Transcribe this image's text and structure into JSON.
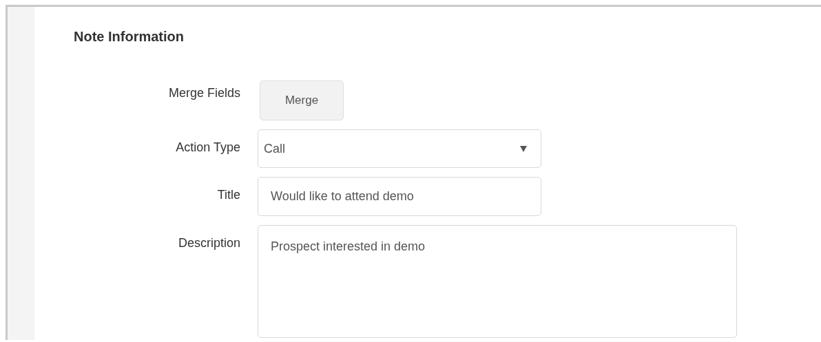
{
  "section": {
    "title": "Note Information"
  },
  "fields": [
    {
      "kind": "button",
      "label": "Merge Fields",
      "button": "Merge"
    },
    {
      "kind": "select",
      "label": "Action Type",
      "value": "Call"
    },
    {
      "kind": "text",
      "label": "Title",
      "value": "Would like to attend demo"
    },
    {
      "kind": "textarea",
      "label": "Description",
      "value": "Prospect interested in demo"
    }
  ]
}
